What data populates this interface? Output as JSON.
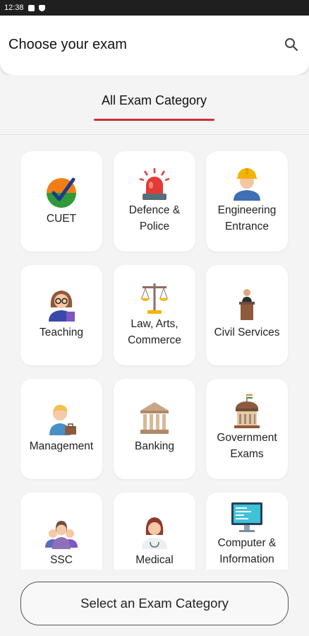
{
  "status_bar": {
    "time": "12:38",
    "icons": [
      "notification-icon",
      "shield-icon"
    ]
  },
  "header": {
    "title": "Choose your exam",
    "search_icon": "search-icon"
  },
  "tabs": [
    {
      "label": "All Exam Category",
      "active": true,
      "underline_color": "#d32f2f"
    }
  ],
  "categories": [
    {
      "label": "CUET",
      "icon": "cuet-check-icon"
    },
    {
      "label": "Defence &\nPolice",
      "icon": "siren-icon"
    },
    {
      "label": "Engineering\nEntrance",
      "icon": "engineer-icon"
    },
    {
      "label": "Teaching",
      "icon": "teacher-icon"
    },
    {
      "label": "Law, Arts,\nCommerce",
      "icon": "scales-icon"
    },
    {
      "label": "Civil Services",
      "icon": "podium-icon"
    },
    {
      "label": "Management",
      "icon": "manager-icon"
    },
    {
      "label": "Banking",
      "icon": "bank-icon"
    },
    {
      "label": "Government\nExams",
      "icon": "government-building-icon"
    },
    {
      "label": "SSC",
      "icon": "group-icon"
    },
    {
      "label": "Medical",
      "icon": "doctor-icon"
    },
    {
      "label": "Computer &\nInformation",
      "icon": "computer-icon"
    }
  ],
  "footer": {
    "select_button_label": "Select an Exam Category"
  }
}
